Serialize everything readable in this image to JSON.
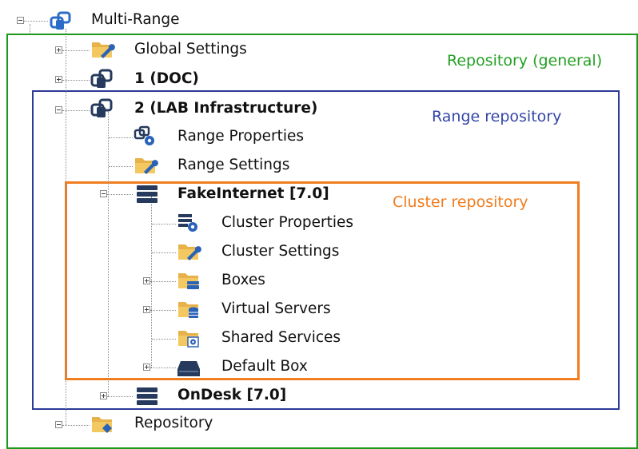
{
  "tree": {
    "root": {
      "label": "Multi-Range",
      "icon": "multi-range-icon"
    },
    "global_settings": {
      "label": "Global Settings",
      "icon": "folder-wrench-icon"
    },
    "repo_doc": {
      "label": "1 (DOC)",
      "icon": "repository-icon"
    },
    "repo_lab": {
      "label": "2 (LAB Infrastructure)",
      "icon": "repository-icon"
    },
    "range_properties": {
      "label": "Range Properties",
      "icon": "range-properties-icon"
    },
    "range_settings": {
      "label": "Range Settings",
      "icon": "folder-wrench-icon"
    },
    "fakeinternet": {
      "label": "FakeInternet [7.0]",
      "icon": "server-stack-icon"
    },
    "cluster_properties": {
      "label": "Cluster Properties",
      "icon": "cluster-properties-icon"
    },
    "cluster_settings": {
      "label": "Cluster Settings",
      "icon": "folder-wrench-icon"
    },
    "boxes": {
      "label": "Boxes",
      "icon": "folder-boxes-icon"
    },
    "virtual_servers": {
      "label": "Virtual Servers",
      "icon": "folder-database-icon"
    },
    "shared_services": {
      "label": "Shared Services",
      "icon": "folder-gear-icon"
    },
    "default_box": {
      "label": "Default Box",
      "icon": "box-icon"
    },
    "ondesk": {
      "label": "OnDesk [7.0]",
      "icon": "server-stack-icon"
    },
    "repository": {
      "label": "Repository",
      "icon": "folder-repository-icon"
    }
  },
  "annotations": {
    "general": "Repository (general)",
    "range": "Range repository",
    "cluster": "Cluster  repository"
  },
  "colors": {
    "general": "#1a9a1a",
    "range": "#2c3a98",
    "cluster": "#f07d1e"
  }
}
